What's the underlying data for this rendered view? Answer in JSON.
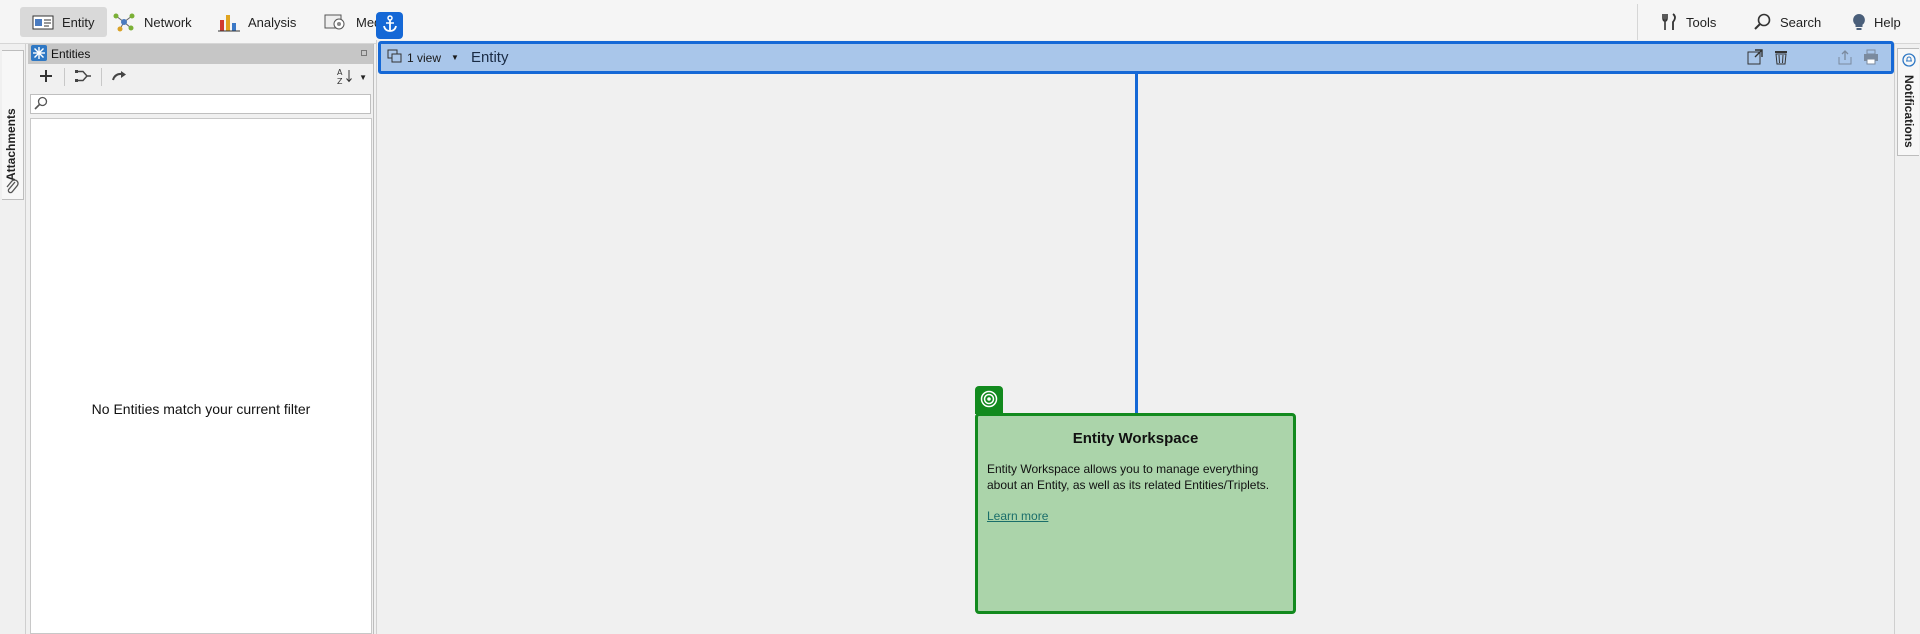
{
  "menu": {
    "entity_label": "Entity",
    "network_label": "Network",
    "analysis_label": "Analysis",
    "media_label": "Med",
    "tools_label": "Tools",
    "search_label": "Search",
    "help_label": "Help"
  },
  "left_tab": {
    "label": "Attachments"
  },
  "right_tab": {
    "label": "Notifications"
  },
  "entities_panel": {
    "title": "Entities",
    "search_value": "",
    "empty_message": "No Entities match your current filter"
  },
  "view_bar": {
    "views_label": "1 view",
    "title": "Entity"
  },
  "workspace_card": {
    "title": "Entity Workspace",
    "description": "Entity Workspace allows you to manage everything about an Entity, as well as its related Entities/Triplets.",
    "link_label": "Learn more"
  },
  "colors": {
    "accent_blue": "#1568d6",
    "viewbar_fill": "#a9c6ea",
    "card_green": "#128a1e",
    "card_fill": "#abd4aa"
  }
}
